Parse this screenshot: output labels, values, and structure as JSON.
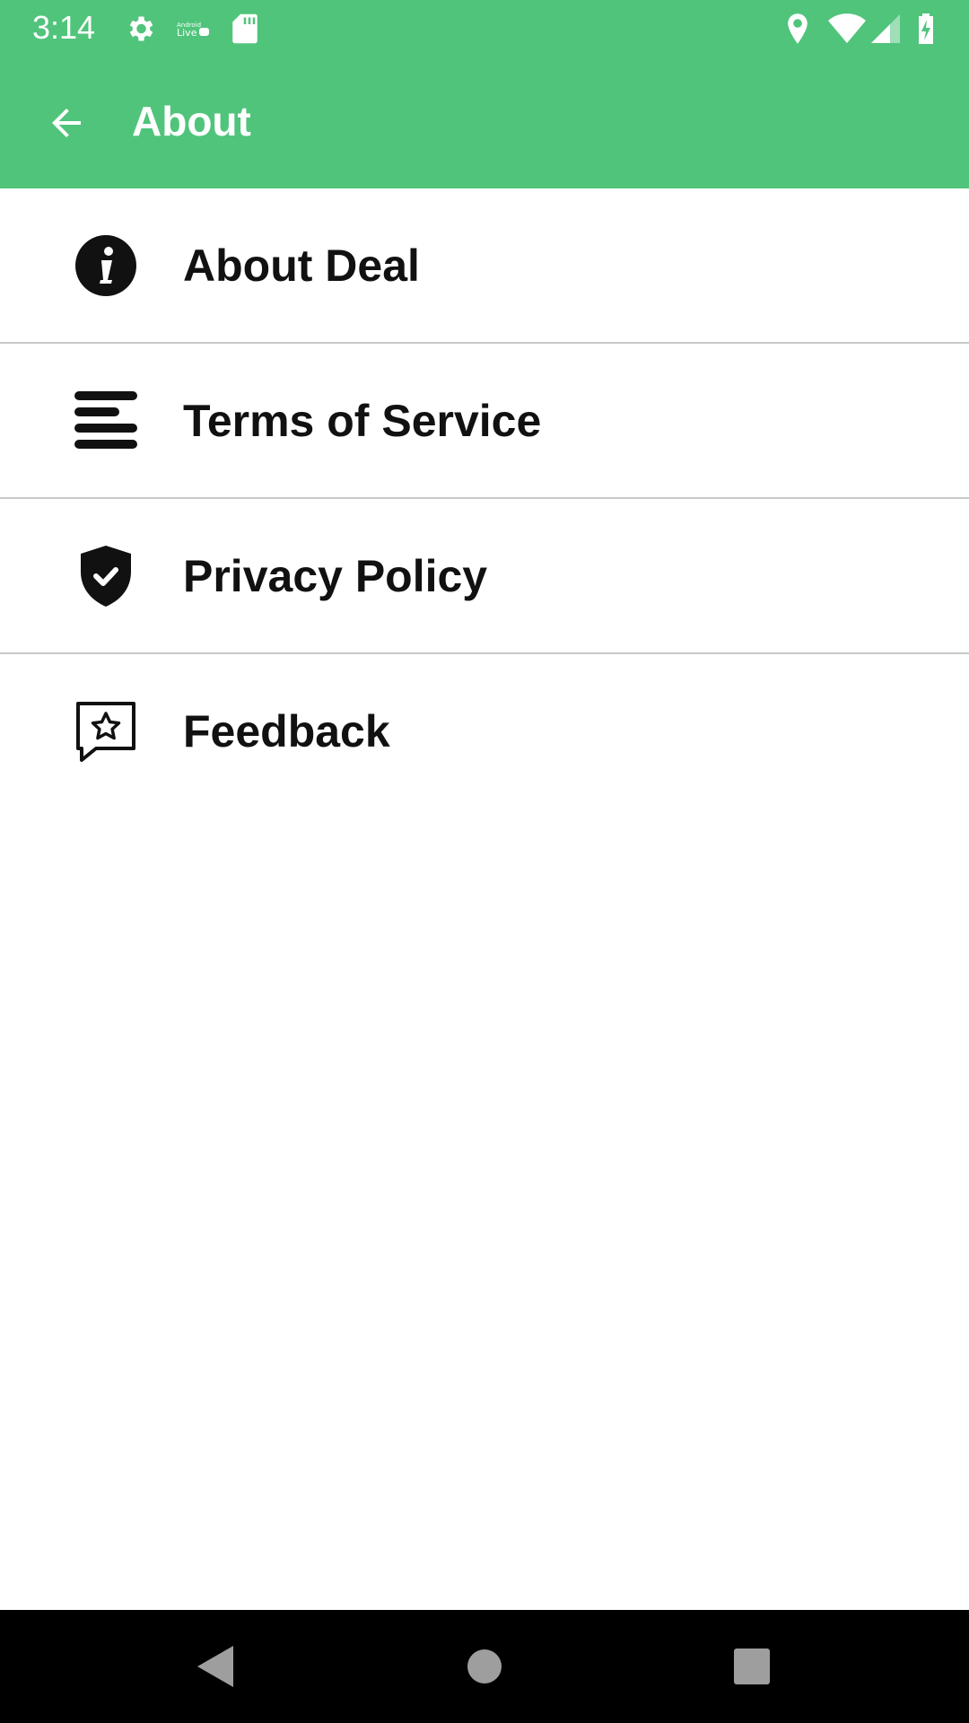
{
  "status_bar": {
    "time": "3:14",
    "icons": [
      "settings-icon",
      "android-live-icon",
      "sd-card-icon",
      "location-icon",
      "wifi-icon",
      "cell-signal-icon",
      "battery-charging-icon"
    ],
    "color": "#50c47b"
  },
  "app_bar": {
    "title": "About",
    "back_icon": "arrow-left-icon",
    "color": "#50c47b"
  },
  "menu": {
    "items": [
      {
        "label": "About Deal",
        "icon": "info-icon"
      },
      {
        "label": "Terms of Service",
        "icon": "text-lines-icon"
      },
      {
        "label": "Privacy Policy",
        "icon": "shield-check-icon"
      },
      {
        "label": "Feedback",
        "icon": "feedback-star-icon"
      }
    ]
  },
  "nav_bar": {
    "buttons": [
      "back-triangle-icon",
      "home-circle-icon",
      "recents-square-icon"
    ]
  }
}
